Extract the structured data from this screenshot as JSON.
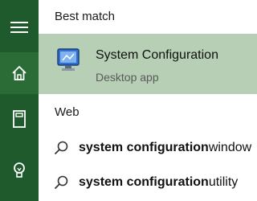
{
  "sidebar": {
    "items": [
      {
        "icon": "hamburger-menu-icon"
      },
      {
        "icon": "home-icon"
      },
      {
        "icon": "notebook-icon"
      },
      {
        "icon": "lightbulb-icon"
      }
    ]
  },
  "best_match": {
    "label": "Best match",
    "item": {
      "title": "System Configuration",
      "subtitle": "Desktop app",
      "icon": "system-configuration-app-icon"
    }
  },
  "web": {
    "label": "Web",
    "results": [
      {
        "query": "system configuration",
        "suggestion": " window"
      },
      {
        "query": "system configuration",
        "suggestion": " utility"
      }
    ]
  },
  "colors": {
    "sidebar_bg": "#1e5a2b",
    "sidebar_active_bg": "#2a6b36",
    "best_match_bg": "#b6cfb5"
  }
}
